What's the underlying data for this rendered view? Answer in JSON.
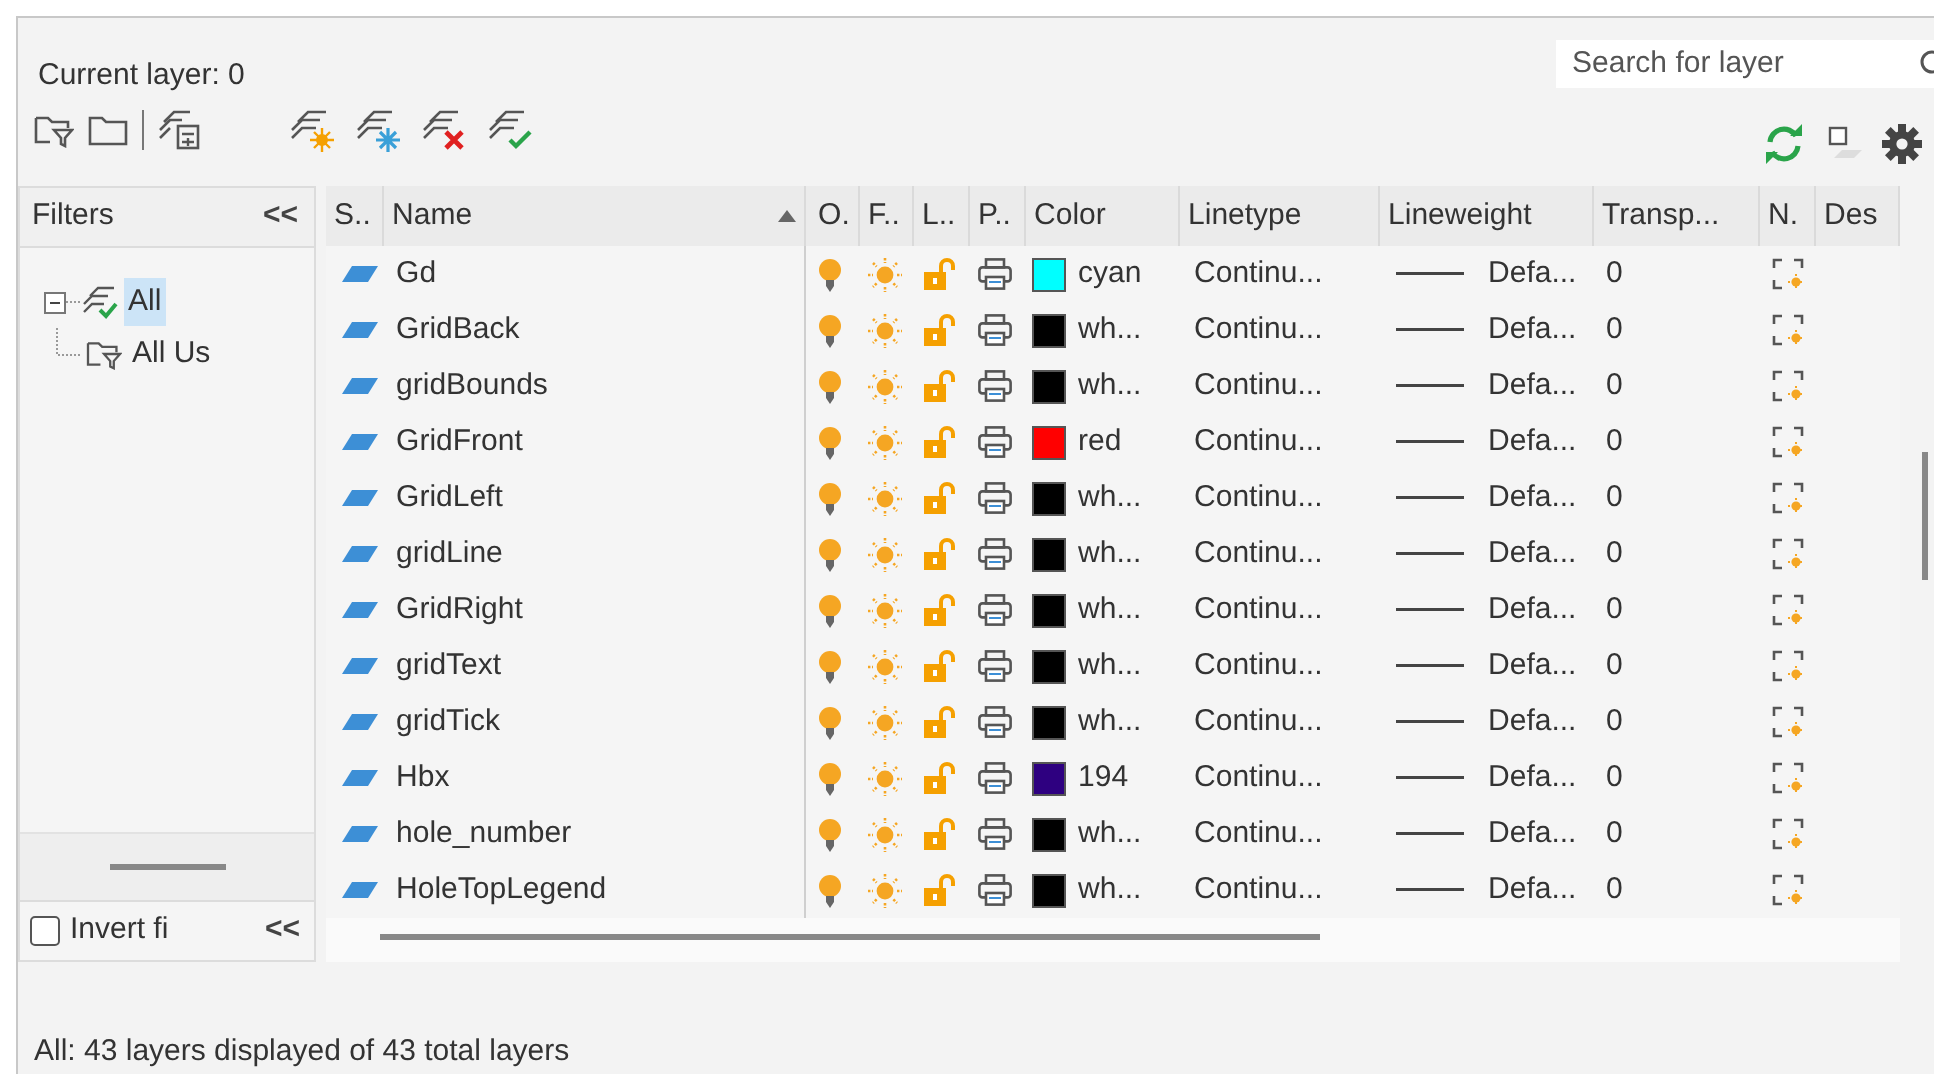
{
  "current_layer": "Current layer: 0",
  "search": {
    "placeholder": "Search for layer"
  },
  "filters": {
    "title": "Filters",
    "collapse": "<<",
    "tree": [
      {
        "label": "All",
        "selected": true,
        "expanded": true,
        "children": [
          {
            "label": "All Us",
            "selected": false
          }
        ]
      }
    ],
    "invert": {
      "label": "Invert fi",
      "checked": false
    },
    "invert_collapse": "<<"
  },
  "table": {
    "columns": [
      {
        "label": "S.."
      },
      {
        "label": "Name",
        "sort_ascending": true
      },
      {
        "label": "O."
      },
      {
        "label": "F.."
      },
      {
        "label": "L.."
      },
      {
        "label": "P.."
      },
      {
        "label": "Color"
      },
      {
        "label": "Linetype"
      },
      {
        "label": "Lineweight"
      },
      {
        "label": "Transp..."
      },
      {
        "label": "N."
      },
      {
        "label": "Des"
      }
    ],
    "rows": [
      {
        "name": "Gd",
        "on": true,
        "frozen": false,
        "locked": false,
        "plot": true,
        "color": "#00ffff",
        "color_name": "cyan",
        "linetype": "Continu...",
        "lineweight": "Defa...",
        "transparency": "0"
      },
      {
        "name": "GridBack",
        "on": true,
        "frozen": false,
        "locked": false,
        "plot": true,
        "color": "#000000",
        "color_name": "wh...",
        "linetype": "Continu...",
        "lineweight": "Defa...",
        "transparency": "0"
      },
      {
        "name": "gridBounds",
        "on": true,
        "frozen": false,
        "locked": false,
        "plot": true,
        "color": "#000000",
        "color_name": "wh...",
        "linetype": "Continu...",
        "lineweight": "Defa...",
        "transparency": "0"
      },
      {
        "name": "GridFront",
        "on": true,
        "frozen": false,
        "locked": false,
        "plot": true,
        "color": "#ff0000",
        "color_name": "red",
        "linetype": "Continu...",
        "lineweight": "Defa...",
        "transparency": "0"
      },
      {
        "name": "GridLeft",
        "on": true,
        "frozen": false,
        "locked": false,
        "plot": true,
        "color": "#000000",
        "color_name": "wh...",
        "linetype": "Continu...",
        "lineweight": "Defa...",
        "transparency": "0"
      },
      {
        "name": "gridLine",
        "on": true,
        "frozen": false,
        "locked": false,
        "plot": true,
        "color": "#000000",
        "color_name": "wh...",
        "linetype": "Continu...",
        "lineweight": "Defa...",
        "transparency": "0"
      },
      {
        "name": "GridRight",
        "on": true,
        "frozen": false,
        "locked": false,
        "plot": true,
        "color": "#000000",
        "color_name": "wh...",
        "linetype": "Continu...",
        "lineweight": "Defa...",
        "transparency": "0"
      },
      {
        "name": "gridText",
        "on": true,
        "frozen": false,
        "locked": false,
        "plot": true,
        "color": "#000000",
        "color_name": "wh...",
        "linetype": "Continu...",
        "lineweight": "Defa...",
        "transparency": "0"
      },
      {
        "name": "gridTick",
        "on": true,
        "frozen": false,
        "locked": false,
        "plot": true,
        "color": "#000000",
        "color_name": "wh...",
        "linetype": "Continu...",
        "lineweight": "Defa...",
        "transparency": "0"
      },
      {
        "name": "Hbx",
        "on": true,
        "frozen": false,
        "locked": false,
        "plot": true,
        "color": "#2e0080",
        "color_name": "194",
        "linetype": "Continu...",
        "lineweight": "Defa...",
        "transparency": "0"
      },
      {
        "name": "hole_number",
        "on": true,
        "frozen": false,
        "locked": false,
        "plot": true,
        "color": "#000000",
        "color_name": "wh...",
        "linetype": "Continu...",
        "lineweight": "Defa...",
        "transparency": "0"
      },
      {
        "name": "HoleTopLegend",
        "on": true,
        "frozen": false,
        "locked": false,
        "plot": true,
        "color": "#000000",
        "color_name": "wh...",
        "linetype": "Continu...",
        "lineweight": "Defa...",
        "transparency": "0"
      }
    ]
  },
  "status_bar": "All: 43 layers displayed of 43 total layers"
}
